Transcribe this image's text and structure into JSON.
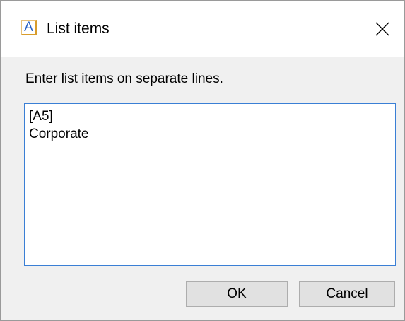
{
  "window": {
    "icon_glyph": "A",
    "icon_name": "text-app-icon",
    "title": "List items",
    "close_icon": "close-icon"
  },
  "prompt": "Enter list items on separate lines.",
  "list_items": [
    "[A5]",
    "Corporate"
  ],
  "buttons": {
    "ok_label": "OK",
    "cancel_label": "Cancel"
  },
  "colors": {
    "accent_border": "#3a7fd5",
    "icon_letter": "#2a63c6",
    "icon_frame": "#d89c2c"
  }
}
